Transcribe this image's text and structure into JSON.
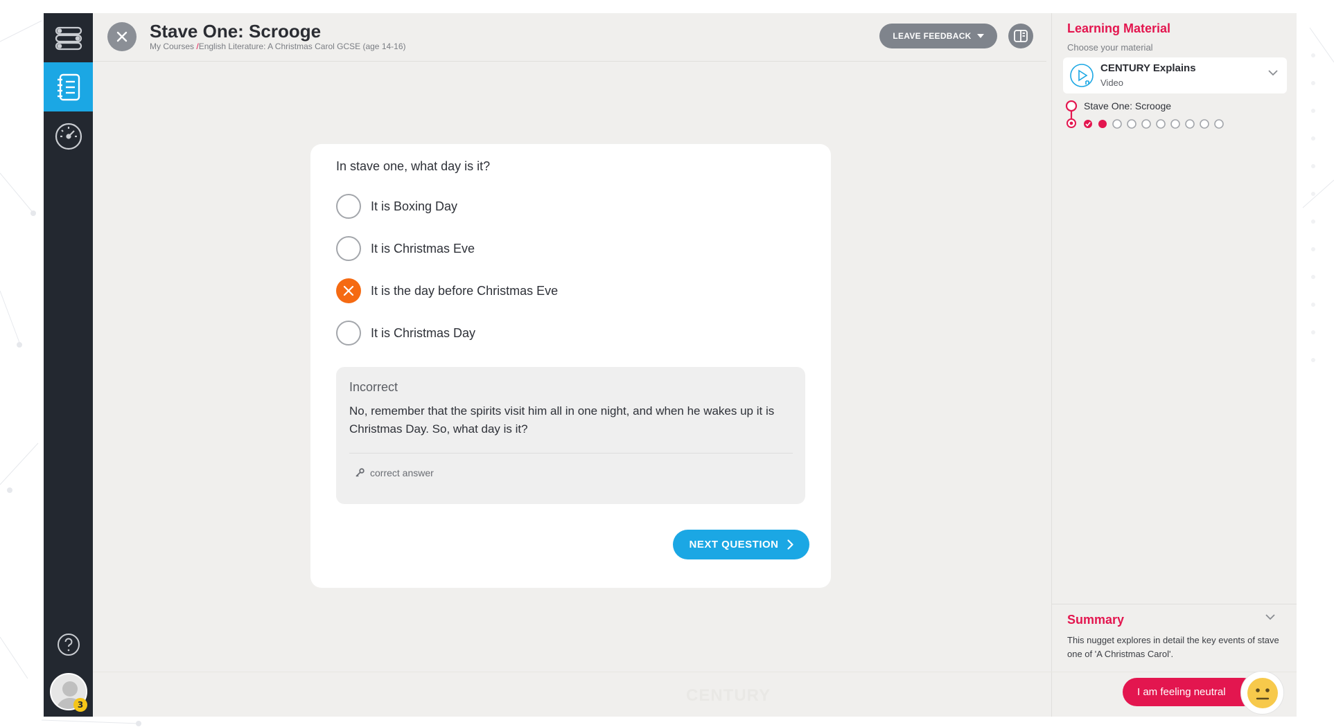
{
  "header": {
    "title": "Stave One: Scrooge",
    "breadcrumb_root": "My Courses",
    "breadcrumb_separator": "/",
    "breadcrumb_course": "English Literature: A Christmas Carol GCSE (age 14-16)",
    "feedback_label": "LEAVE FEEDBACK"
  },
  "question": {
    "text": "In stave one, what day is it?",
    "options": [
      {
        "label": "It is Boxing Day",
        "state": "unselected"
      },
      {
        "label": "It is Christmas Eve",
        "state": "unselected"
      },
      {
        "label": "It is the day before Christmas Eve",
        "state": "incorrect"
      },
      {
        "label": "It is Christmas Day",
        "state": "unselected"
      }
    ],
    "feedback_title": "Incorrect",
    "feedback_text": "No, remember that the spirits visit him all in one night, and when he wakes up it is Christmas Day. So, what day is it?",
    "correct_answer_label": "correct answer",
    "next_label": "NEXT QUESTION"
  },
  "right_panel": {
    "title": "Learning Material",
    "subtitle": "Choose your material",
    "material_name": "CENTURY Explains",
    "material_type": "Video",
    "track_label": "Stave One: Scrooge",
    "progress": {
      "total_questions": 10,
      "completed": 1,
      "current": 2
    }
  },
  "summary": {
    "title": "Summary",
    "text": "This nugget explores in detail the key events of stave one of 'A Christmas Carol'."
  },
  "footer": {
    "watermark": "CENTURY",
    "mood_label": "I am feeling neutral",
    "avatar_badge": "3"
  },
  "colors": {
    "accent_blue": "#1ba7e4",
    "accent_pink": "#e3164f",
    "incorrect_orange": "#f56a12",
    "sidebar": "#232830"
  },
  "icons": {
    "sidebar": [
      "pathway-icon",
      "notes-icon",
      "dashboard-gauge-icon",
      "help-icon"
    ],
    "header": [
      "close-icon",
      "caret-down-icon",
      "panel-toggle-icon"
    ]
  }
}
